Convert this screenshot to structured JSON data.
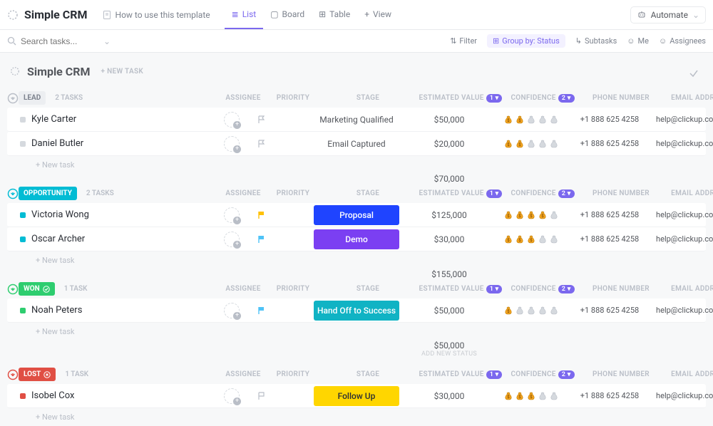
{
  "header": {
    "title": "Simple CRM",
    "template_label": "How to use this template",
    "views": [
      {
        "id": "list",
        "label": "List",
        "active": true
      },
      {
        "id": "board",
        "label": "Board",
        "active": false
      },
      {
        "id": "table",
        "label": "Table",
        "active": false
      },
      {
        "id": "addview",
        "label": "View",
        "active": false
      }
    ],
    "automate_label": "Automate"
  },
  "filterbar": {
    "search_placeholder": "Search tasks...",
    "filter": "Filter",
    "groupby": "Group by: Status",
    "subtasks": "Subtasks",
    "me": "Me",
    "assignees": "Assignees"
  },
  "page": {
    "title": "Simple CRM",
    "new_task": "+ NEW TASK"
  },
  "columns": {
    "assignee": "ASSIGNEE",
    "priority": "PRIORITY",
    "stage": "STAGE",
    "est_value": "ESTIMATED VALUE",
    "est_badge": "1 ▾",
    "confidence": "CONFIDENCE",
    "conf_badge": "2 ▾",
    "phone": "PHONE NUMBER",
    "email": "EMAIL ADDRESS"
  },
  "labels": {
    "new_task_row": "+ New task",
    "add_status": "ADD NEW STATUS"
  },
  "groups": [
    {
      "id": "lead",
      "name": "LEAD",
      "color": "#b9bec7",
      "text_color": "#7c828d",
      "bg": "#eceef1",
      "count_label": "2 TASKS",
      "icon": "none",
      "rows": [
        {
          "name": "Kyle Carter",
          "sq": "#d5d9de",
          "flag": "none",
          "flag_color": "#b9bec7",
          "stage": "Marketing Qualified",
          "stage_bg": "transparent",
          "stage_color": "#54575d",
          "value": "$50,000",
          "conf": 2,
          "phone": "+1 888 625 4258",
          "email": "help@clickup.com"
        },
        {
          "name": "Daniel Butler",
          "sq": "#d5d9de",
          "flag": "none",
          "flag_color": "#b9bec7",
          "stage": "Email Captured",
          "stage_bg": "transparent",
          "stage_color": "#54575d",
          "value": "$20,000",
          "conf": 2,
          "phone": "+1 888 625 4258",
          "email": "help@clickup.com"
        }
      ],
      "total": "$70,000"
    },
    {
      "id": "opportunity",
      "name": "OPPORTUNITY",
      "color": "#02BCD4",
      "text_color": "#ffffff",
      "bg": "#02BCD4",
      "count_label": "2 TASKS",
      "icon": "none",
      "rows": [
        {
          "name": "Victoria Wong",
          "sq": "#02BCD4",
          "flag": "solid",
          "flag_color": "#ffc107",
          "stage": "Proposal",
          "stage_bg": "#1f44ff",
          "stage_color": "#fff",
          "value": "$125,000",
          "conf": 4,
          "phone": "+1 888 625 4258",
          "email": "help@clickup.com"
        },
        {
          "name": "Oscar Archer",
          "sq": "#02BCD4",
          "flag": "solid",
          "flag_color": "#4fc3f7",
          "stage": "Demo",
          "stage_bg": "#7b3ff2",
          "stage_color": "#fff",
          "value": "$30,000",
          "conf": 3,
          "phone": "+1 888 625 4258",
          "email": "help@clickup.com"
        }
      ],
      "total": "$155,000"
    },
    {
      "id": "won",
      "name": "WON",
      "color": "#2ecd6f",
      "text_color": "#ffffff",
      "bg": "#2ecd6f",
      "count_label": "1 TASK",
      "icon": "check",
      "rows": [
        {
          "name": "Noah Peters",
          "sq": "#2ecd6f",
          "flag": "solid",
          "flag_color": "#4fc3f7",
          "stage": "Hand Off to Success",
          "stage_bg": "#10b3c4",
          "stage_color": "#fff",
          "value": "$50,000",
          "conf": 1,
          "phone": "+1 888 625 4258",
          "email": "help@clickup.com"
        }
      ],
      "total": "$50,000",
      "show_add_status": true
    },
    {
      "id": "lost",
      "name": "LOST",
      "color": "#e04f44",
      "text_color": "#ffffff",
      "bg": "#e04f44",
      "count_label": "1 TASK",
      "icon": "cancel",
      "rows": [
        {
          "name": "Isobel Cox",
          "sq": "#e04f44",
          "flag": "outline",
          "flag_color": "#b9bec7",
          "stage": "Follow Up",
          "stage_bg": "#ffd600",
          "stage_color": "#292d34",
          "value": "$30,000",
          "conf": 3,
          "phone": "+1 888 625 4258",
          "email": "help@clickup.com"
        }
      ],
      "total": ""
    }
  ]
}
